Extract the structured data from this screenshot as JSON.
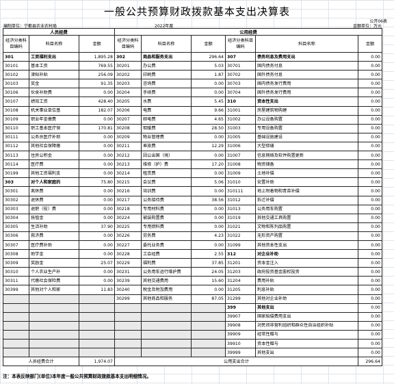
{
  "title": "一般公共预算财政拨款基本支出决算表",
  "form_no": "公开06表",
  "unit_left": "编制单位：宁都县农业农村局",
  "year": "2022年度",
  "unit_right": "金额单位：万元",
  "sections": {
    "personnel": "人员经费",
    "public": "公用经费"
  },
  "headers": {
    "code": "经济分类科目编码",
    "name": "科目名称",
    "amount": "金额"
  },
  "rows": [
    [
      "301",
      "工资福利支出",
      "1,895.28",
      "302",
      "商品和服务支出",
      "296.64",
      "307",
      "债务利息及费用支出",
      "0.00"
    ],
    [
      "30101",
      "基本工资",
      "769.55",
      "30201",
      "办公费",
      "5.03",
      "30701",
      "国内债务付息",
      "0.00"
    ],
    [
      "30102",
      "津贴补贴",
      "256.09",
      "30202",
      "印刷费",
      "1.87",
      "30702",
      "国外债务付息",
      "0.00"
    ],
    [
      "30103",
      "奖金",
      "91.35",
      "30203",
      "咨询费",
      "0.00",
      "30703",
      "国内债务发行费用",
      "0.00"
    ],
    [
      "30106",
      "伙食补助费",
      "0.00",
      "30204",
      "手续费",
      "0.00",
      "30704",
      "国外债务发行费用",
      "0.00"
    ],
    [
      "30107",
      "绩效工资",
      "428.40",
      "30205",
      "水费",
      "5.45",
      "310",
      "资本性支出",
      "0.00"
    ],
    [
      "30108",
      "机关事业单位基",
      "182.07",
      "30206",
      "电费",
      "9.66",
      "31001",
      "房屋建筑物购建",
      "0.00"
    ],
    [
      "30109",
      "职业年金缴费",
      "0.00",
      "30207",
      "邮电费",
      "4.65",
      "31002",
      "办公设备购置",
      "0.00"
    ],
    [
      "30110",
      "职工基本医疗保",
      "170.81",
      "30208",
      "取暖费",
      "28.50",
      "31003",
      "专用设备购置",
      "0.00"
    ],
    [
      "30111",
      "公务员医疗补助",
      "0.00",
      "30209",
      "物业管理费",
      "0.00",
      "31005",
      "基础设施建设",
      "0.00"
    ],
    [
      "30112",
      "其他社会保障缴",
      "0.00",
      "30211",
      "差旅费",
      "12.29",
      "31006",
      "大型修缮",
      "0.00"
    ],
    [
      "30113",
      "住房公积金",
      "0.00",
      "30212",
      "因公出国（境）",
      "0.00",
      "31007",
      "信息网络及软件购置更新",
      "0.00"
    ],
    [
      "30114",
      "医疗费",
      "0.00",
      "30213",
      "维修（护）费",
      "17.20",
      "31008",
      "物资储备",
      "0.00"
    ],
    [
      "30199",
      "其他工资福利支",
      "0.00",
      "30214",
      "租赁费",
      "0.00",
      "31009",
      "土地补偿",
      "0.00"
    ],
    [
      "303",
      "对个人和家庭的",
      "75.80",
      "30215",
      "会议费",
      "5.06",
      "31010",
      "安置补助",
      "0.00"
    ],
    [
      "30301",
      "离休费",
      "0.00",
      "30216",
      "培训费",
      "0.00",
      "310111",
      "地上附着物和青苗补偿",
      "0.00"
    ],
    [
      "30302",
      "退休费",
      "0.00",
      "30217",
      "公务接待费",
      "38.56",
      "31012",
      "拆迁补偿",
      "0.00"
    ],
    [
      "30303",
      "退职（役）费",
      "0.00",
      "30218",
      "专用材料费",
      "0.00",
      "31013",
      "公务用车购置",
      "0.00"
    ],
    [
      "30304",
      "抚恤金",
      "0.00",
      "30224",
      "被装购置费",
      "0.00",
      "31019",
      "其他交通工具购置",
      "0.00"
    ],
    [
      "30305",
      "生活补助",
      "37.90",
      "30225",
      "专用燃料费",
      "0.00",
      "31021",
      "文物和陈列品购置",
      "0.00"
    ],
    [
      "30306",
      "救济费",
      "0.00",
      "30226",
      "劳务费",
      "4.23",
      "31022",
      "无形资产购置",
      "0.00"
    ],
    [
      "30307",
      "医疗费补助",
      "0.00",
      "30227",
      "委托业务费",
      "0.00",
      "31099",
      "其他资本性支出",
      "0.00"
    ],
    [
      "30308",
      "助学金",
      "0.00",
      "30228",
      "工会经费",
      "2.55",
      "312",
      "对企业补助",
      "0.00"
    ],
    [
      "30309",
      "奖励金",
      "25.07",
      "30229",
      "福利费",
      "37.85",
      "31201",
      "资本金注入",
      "0.00"
    ],
    [
      "30310",
      "个人农业生产补",
      "0.00",
      "30231",
      "公务用车运行维护费",
      "24.05",
      "31203",
      "政府投资基金股权投资",
      "0.00"
    ],
    [
      "30311",
      "代缴社会保险费",
      "0.00",
      "30239",
      "其他交通费用",
      "15.60",
      "31204",
      "费用补贴",
      "0.00"
    ],
    [
      "30399",
      "其他对个人和家",
      "11.83",
      "30240",
      "税金及附加费用",
      "0.00",
      "31205",
      "利息补贴",
      "0.00"
    ],
    [
      "",
      "",
      "",
      "30299",
      "其他商品和服务",
      "87.05",
      "31299",
      "其他对企业补助",
      "0.00"
    ],
    [
      "",
      "",
      "",
      "",
      "",
      "",
      "399",
      "其他支出",
      "0.00"
    ],
    [
      "",
      "",
      "",
      "",
      "",
      "",
      "39907",
      "国家赔偿费用支出",
      "0.00"
    ],
    [
      "",
      "",
      "",
      "",
      "",
      "",
      "39908",
      "对民间非营利组织和群众性自治组织补贴",
      "0.00"
    ],
    [
      "",
      "",
      "",
      "",
      "",
      "",
      "39909",
      "经常性赠与",
      "0.00"
    ],
    [
      "",
      "",
      "",
      "",
      "",
      "",
      "39910",
      "资本性赠与",
      "0.00"
    ],
    [
      "",
      "",
      "",
      "",
      "",
      "",
      "39999",
      "其他支出",
      "0.00"
    ]
  ],
  "totals": {
    "personnel_label": "人员经费合计",
    "personnel_value": "1,974.07",
    "public_label": "公用支出合计",
    "public_value": "296.64"
  },
  "note": "注：本表反映部门(单位)本年度一般公共预算财政拨款基本支出明细情况。"
}
